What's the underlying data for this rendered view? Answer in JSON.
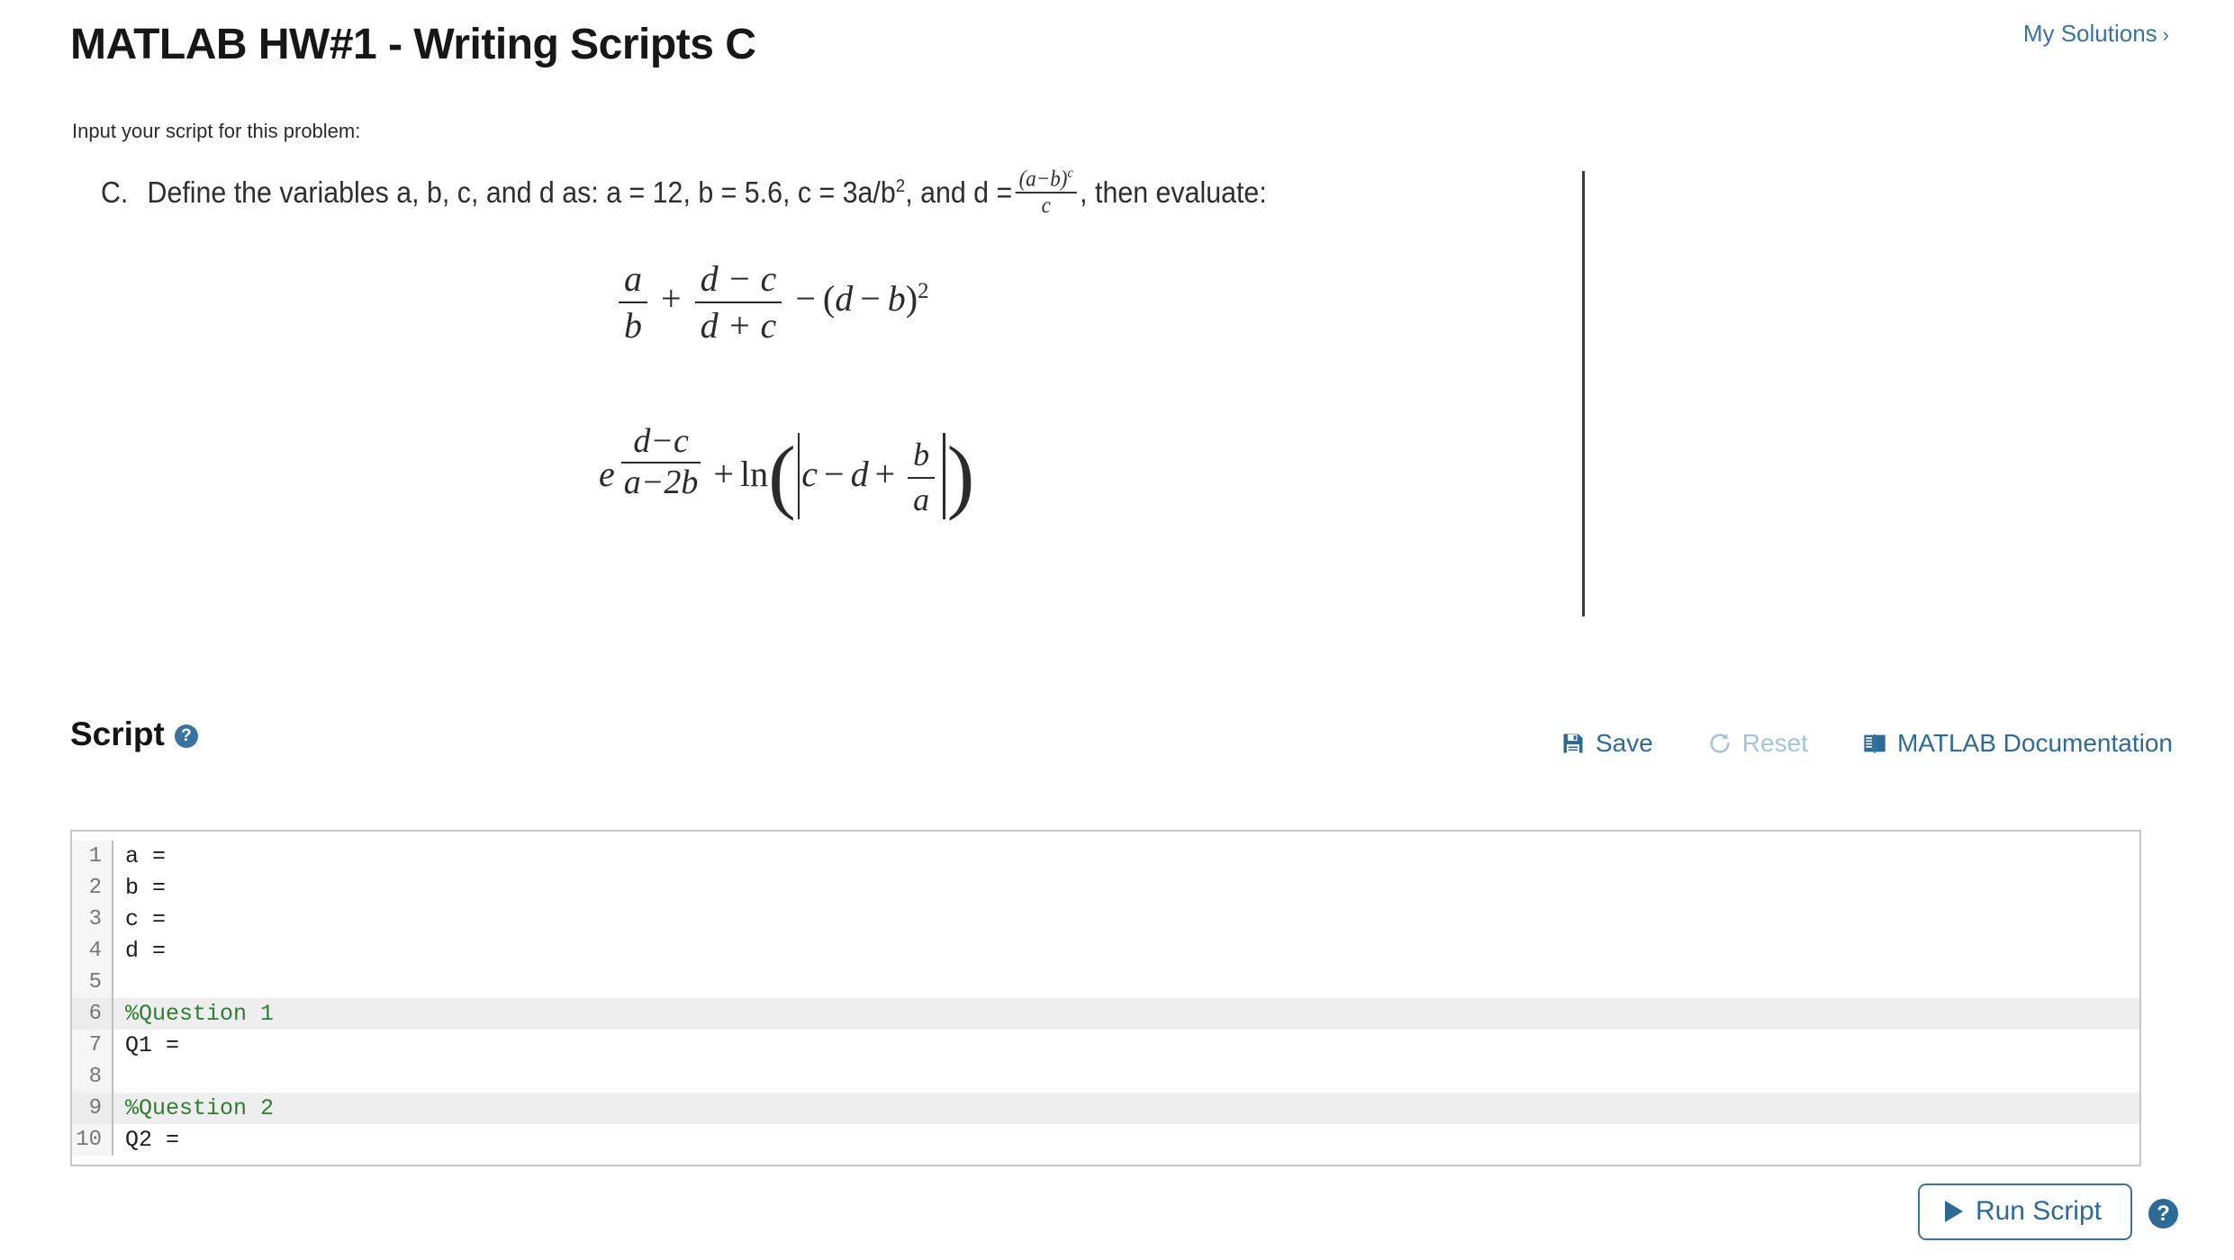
{
  "header": {
    "title": "MATLAB HW#1 - Writing Scripts C",
    "my_solutions_label": "My Solutions",
    "my_solutions_chevron": "›",
    "link_color": "#3a72a0"
  },
  "prompt": {
    "text": "Input your script for this problem:"
  },
  "problem": {
    "letter": "C.",
    "statement_part1": "Define the variables a, b, c, and d as:  a = 12, b = 5.6, c = 3a/b",
    "statement_exp": "2",
    "statement_part2": ", and d =",
    "d_numerator": "(a−b)",
    "d_numerator_exp": "c",
    "d_denominator": "c",
    "statement_part3": ", then evaluate:",
    "expression_1": {
      "f1_num": "a",
      "f1_den": "b",
      "op1": "+",
      "f2_num": "d − c",
      "f2_den": "d + c",
      "op2": "−",
      "tail_open": "(",
      "tail_d": "d",
      "tail_minus": "−",
      "tail_b": "b",
      "tail_close": ")",
      "tail_exp": "2",
      "latex": "a/b + (d-c)/(d+c) - (d-b)^2"
    },
    "expression_2": {
      "e_base": "e",
      "exp_num": "d−c",
      "exp_den": "a−2b",
      "op1": "+",
      "ln": "ln",
      "inner_c": "c",
      "inner_minus": "−",
      "inner_d": "d",
      "inner_plus": "+",
      "inner_f_num": "b",
      "inner_f_den": "a",
      "latex": "e^((d-c)/(a-2b)) + ln(|c - d + b/a|)"
    }
  },
  "script_section": {
    "title": "Script",
    "help_symbol": "?",
    "tools": [
      {
        "label": "Save",
        "icon": "save-floppy-icon",
        "disabled": false
      },
      {
        "label": "Reset",
        "icon": "reset-refresh-icon",
        "disabled": true
      },
      {
        "label": "MATLAB Documentation",
        "icon": "book-icon",
        "disabled": false
      }
    ],
    "tool_color": "#2e6a96",
    "tool_disabled_color": "#a3c4dc"
  },
  "editor": {
    "lines": [
      {
        "num": "1",
        "text": "a =",
        "comment": false
      },
      {
        "num": "2",
        "text": "b =",
        "comment": false
      },
      {
        "num": "3",
        "text": "c =",
        "comment": false
      },
      {
        "num": "4",
        "text": "d =",
        "comment": false
      },
      {
        "num": "5",
        "text": "",
        "comment": false
      },
      {
        "num": "6",
        "text": "%Question 1",
        "comment": true
      },
      {
        "num": "7",
        "text": "Q1 =",
        "comment": false
      },
      {
        "num": "8",
        "text": "",
        "comment": false
      },
      {
        "num": "9",
        "text": "%Question 2",
        "comment": true
      },
      {
        "num": "10",
        "text": "Q2 =",
        "comment": false
      }
    ],
    "comment_color": "#2e7d32",
    "comment_bg": "#eeeeee"
  },
  "footer": {
    "run_label": "Run Script",
    "help_symbol": "?"
  }
}
